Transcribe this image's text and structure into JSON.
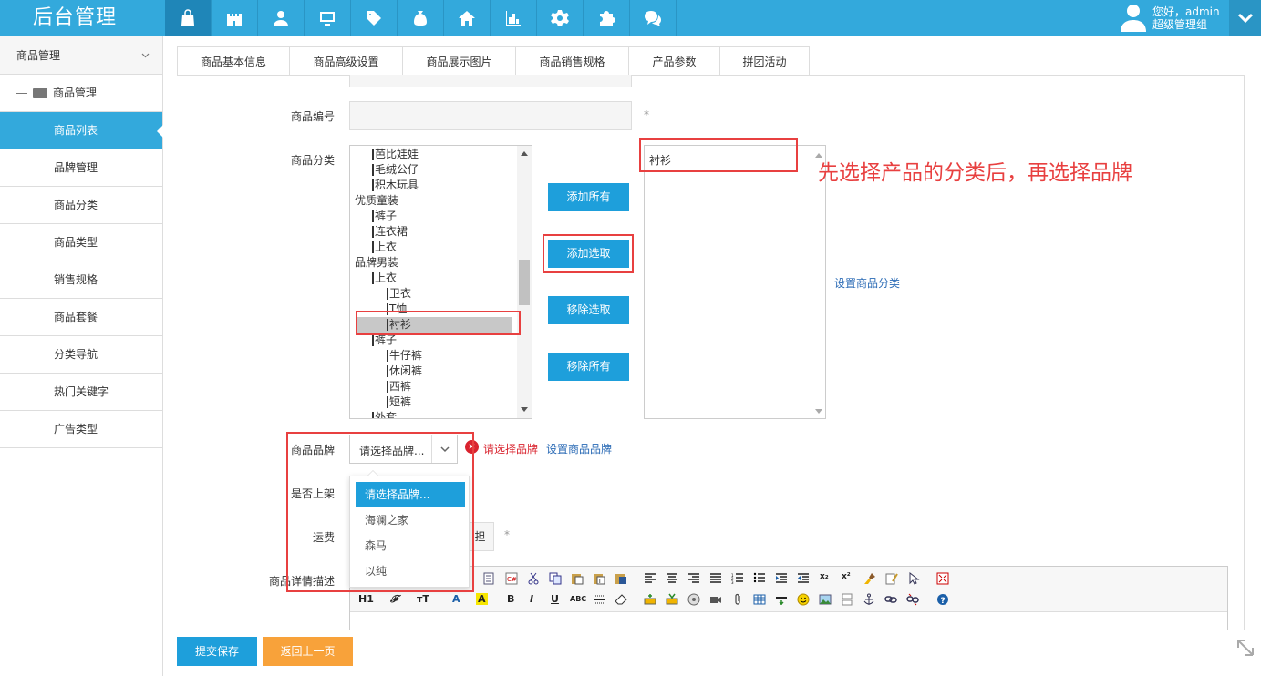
{
  "app": {
    "title": "后台管理"
  },
  "topnav": {
    "icons": [
      "bag-icon",
      "castle-icon",
      "user-icon",
      "monitor-icon",
      "tag-icon",
      "money-bag-icon",
      "home-icon",
      "bar-chart-icon",
      "gear-icon",
      "puzzle-icon",
      "chat-icon"
    ]
  },
  "user": {
    "greeting": "您好，admin",
    "role": "超级管理组"
  },
  "sidebar": {
    "group": "商品管理",
    "subgroup": "商品管理",
    "items": [
      "商品列表",
      "品牌管理",
      "商品分类",
      "商品类型",
      "销售规格",
      "商品套餐",
      "分类导航",
      "热门关键字",
      "广告类型"
    ]
  },
  "tabs": [
    "商品基本信息",
    "商品高级设置",
    "商品展示图片",
    "商品销售规格",
    "产品参数",
    "拼团活动"
  ],
  "form": {
    "code_label": "商品编号",
    "category_label": "商品分类",
    "brand_label": "商品品牌",
    "onsale_label": "是否上架",
    "freight_label": "运费",
    "desc_label": "商品详情描述",
    "required_mark": "*",
    "freight_fragment": "担"
  },
  "tree": [
    "芭比娃娃",
    "毛绒公仔",
    "积木玩具",
    "优质童装",
    "裤子",
    "连衣裙",
    "上衣",
    "品牌男装",
    "上衣",
    "卫衣",
    "T恤",
    "衬衫",
    "裤子",
    "牛仔裤",
    "休闲裤",
    "西裤",
    "短裤",
    "外套"
  ],
  "selected_categories": [
    "衬衫"
  ],
  "buttons": {
    "add_all": "添加所有",
    "add_selected": "添加选取",
    "remove_selected": "移除选取",
    "remove_all": "移除所有",
    "save": "提交保存",
    "back": "返回上一页"
  },
  "links": {
    "set_category": "设置商品分类",
    "set_brand": "设置商品品牌"
  },
  "annotation": "先选择产品的分类后，再选择品牌",
  "brand": {
    "value": "请选择品牌...",
    "error": "请选择品牌",
    "options": [
      "请选择品牌...",
      "海澜之家",
      "森马",
      "以纯"
    ]
  },
  "editor": {
    "heading_btn": "H1",
    "abc": "ABC"
  }
}
